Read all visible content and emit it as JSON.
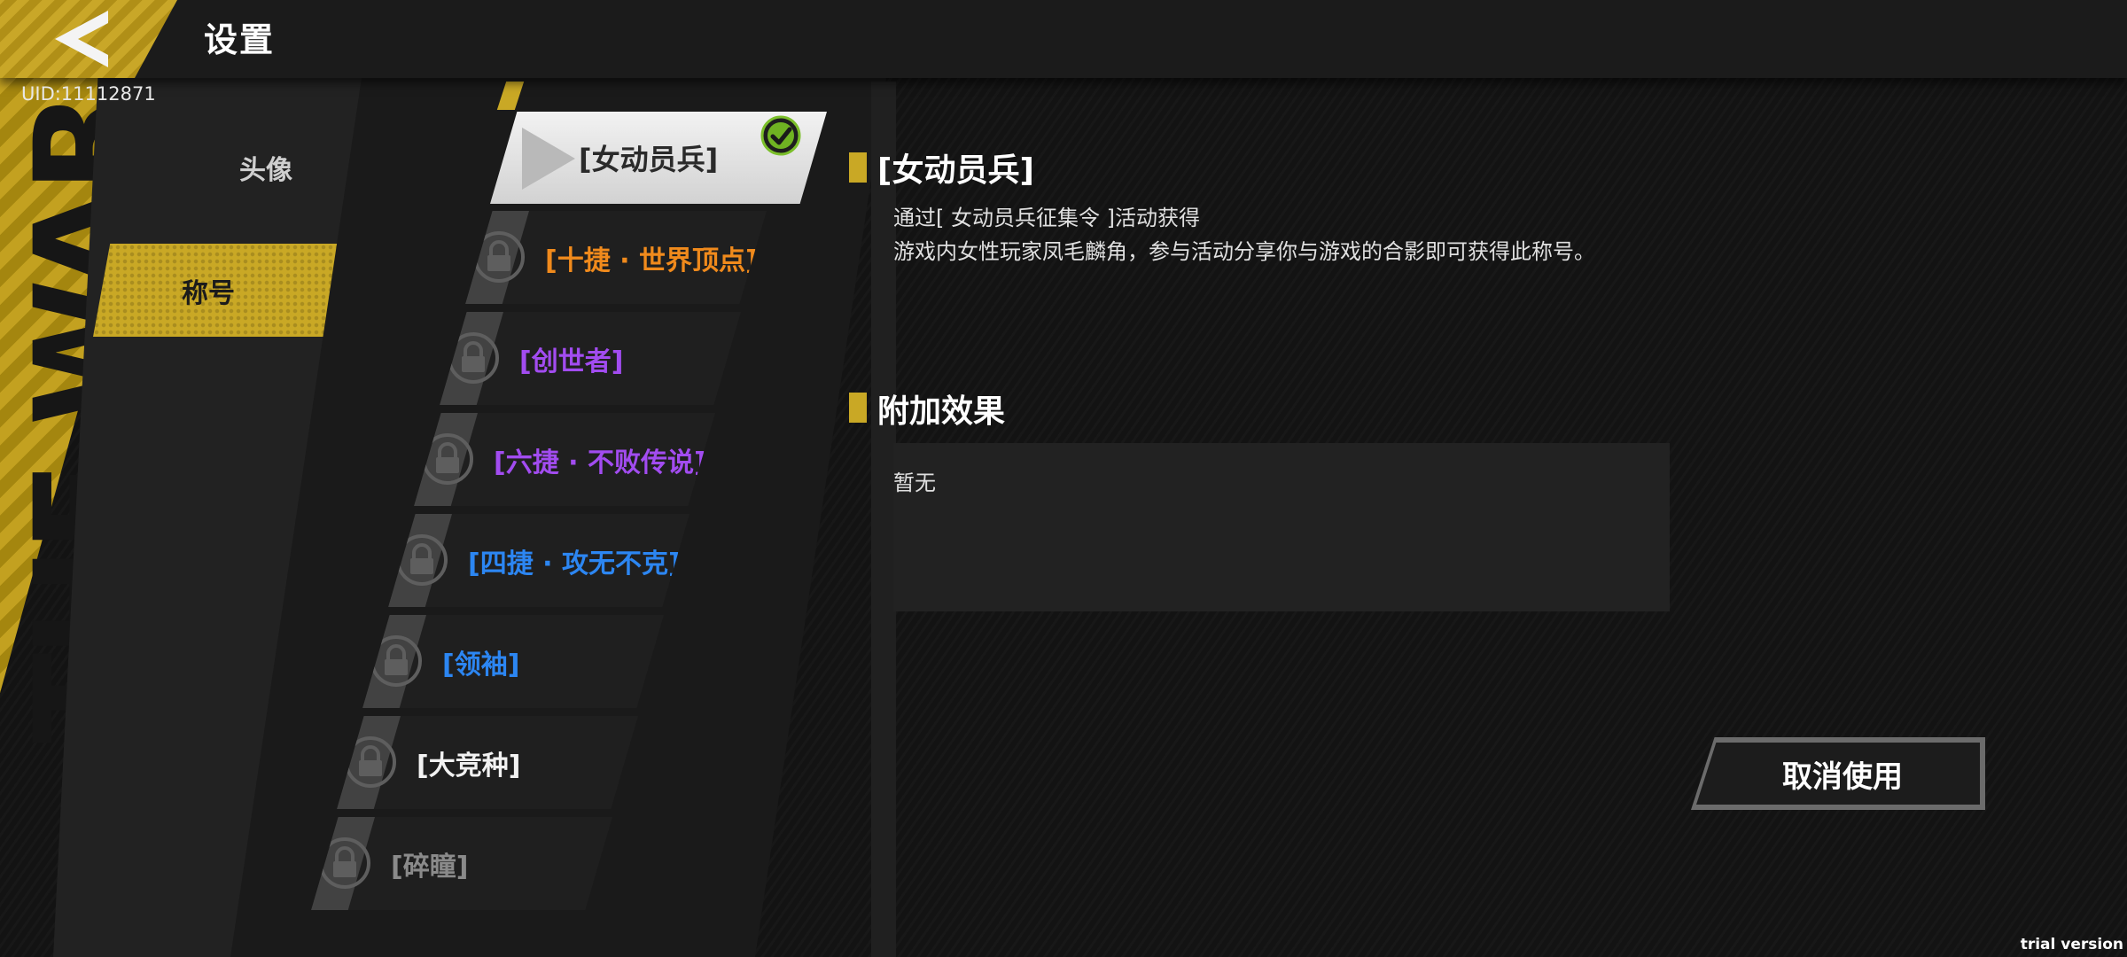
{
  "header": {
    "title": "设置",
    "uid": "UID:11112871"
  },
  "decor": {
    "vertical_text": "THE WAR"
  },
  "categories": [
    {
      "label": "头像",
      "active": false
    },
    {
      "label": "称号",
      "active": true
    }
  ],
  "titles": {
    "selected": {
      "label": "[女动员兵]",
      "equipped": true,
      "color": "#2a2a2a"
    },
    "items": [
      {
        "label": "[十捷 · 世界顶点]",
        "locked": true,
        "color": "#f08a1c"
      },
      {
        "label": "[创世者]",
        "locked": true,
        "color": "#a24cf0"
      },
      {
        "label": "[六捷 · 不败传说]",
        "locked": true,
        "color": "#a24cf0"
      },
      {
        "label": "[四捷 · 攻无不克]",
        "locked": true,
        "color": "#2c86f2"
      },
      {
        "label": "[领袖]",
        "locked": true,
        "color": "#2c86f2"
      },
      {
        "label": "[大竞种]",
        "locked": true,
        "color": "#f2f2f2"
      },
      {
        "label": "[碎瞳]",
        "locked": true,
        "color": "#8a8a8a"
      }
    ]
  },
  "detail": {
    "name": "[女动员兵]",
    "source": "通过[ 女动员兵征集令 ]活动获得",
    "description": "游戏内女性玩家凤毛麟角，参与活动分享你与游戏的合影即可获得此称号。",
    "effect_heading": "附加效果",
    "effect_text": "暂无",
    "cancel_button": "取消使用"
  },
  "watermark": "trial version",
  "colors": {
    "accent_gold": "#c9a825",
    "background": "#131313",
    "panel": "#222222"
  },
  "icons": {
    "back": "back-arrow-icon",
    "lock": "lock-icon",
    "equipped": "check-circle-icon",
    "selected": "triangle-play-icon"
  }
}
